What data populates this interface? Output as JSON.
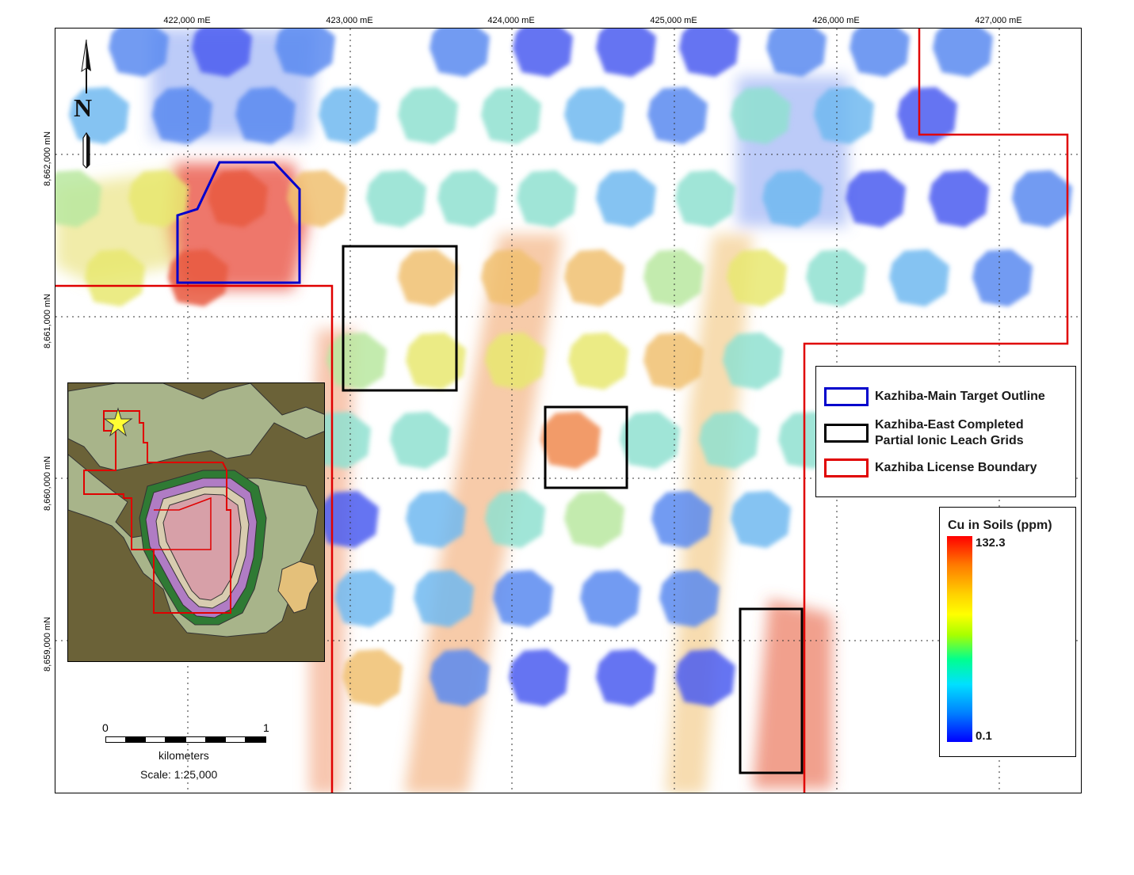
{
  "axes": {
    "x_labels": [
      "422,000 mE",
      "423,000 mE",
      "424,000 mE",
      "425,000 mE",
      "426,000 mE",
      "427,000 mE"
    ],
    "y_labels": [
      "8,662,000 mN",
      "8,661,000 mN",
      "8,660,000 mN",
      "8,659,000 mN"
    ]
  },
  "north_arrow": {
    "letter": "N",
    "icon": "north-arrow-icon"
  },
  "legend": {
    "items": [
      {
        "label": "Kazhiba-Main Target Outline",
        "color": "#0000cc"
      },
      {
        "label": "Kazhiba-East Completed\nPartial Ionic Leach Grids",
        "color": "#000000"
      },
      {
        "label": "Kazhiba License Boundary",
        "color": "#e00000"
      }
    ]
  },
  "colorbar": {
    "title": "Cu in Soils (ppm)",
    "max": "132.3",
    "min": "0.1",
    "colors": [
      "#ff0000",
      "#ffd000",
      "#ffff00",
      "#00ff90",
      "#00e0ff",
      "#0000ff"
    ]
  },
  "scale_bar": {
    "tick_start": "0",
    "tick_end": "1",
    "unit": "kilometers",
    "scale": "Scale: 1:25,000"
  },
  "inset_map": {
    "star_color": "#ffff33",
    "boundary_color": "#e00000"
  }
}
